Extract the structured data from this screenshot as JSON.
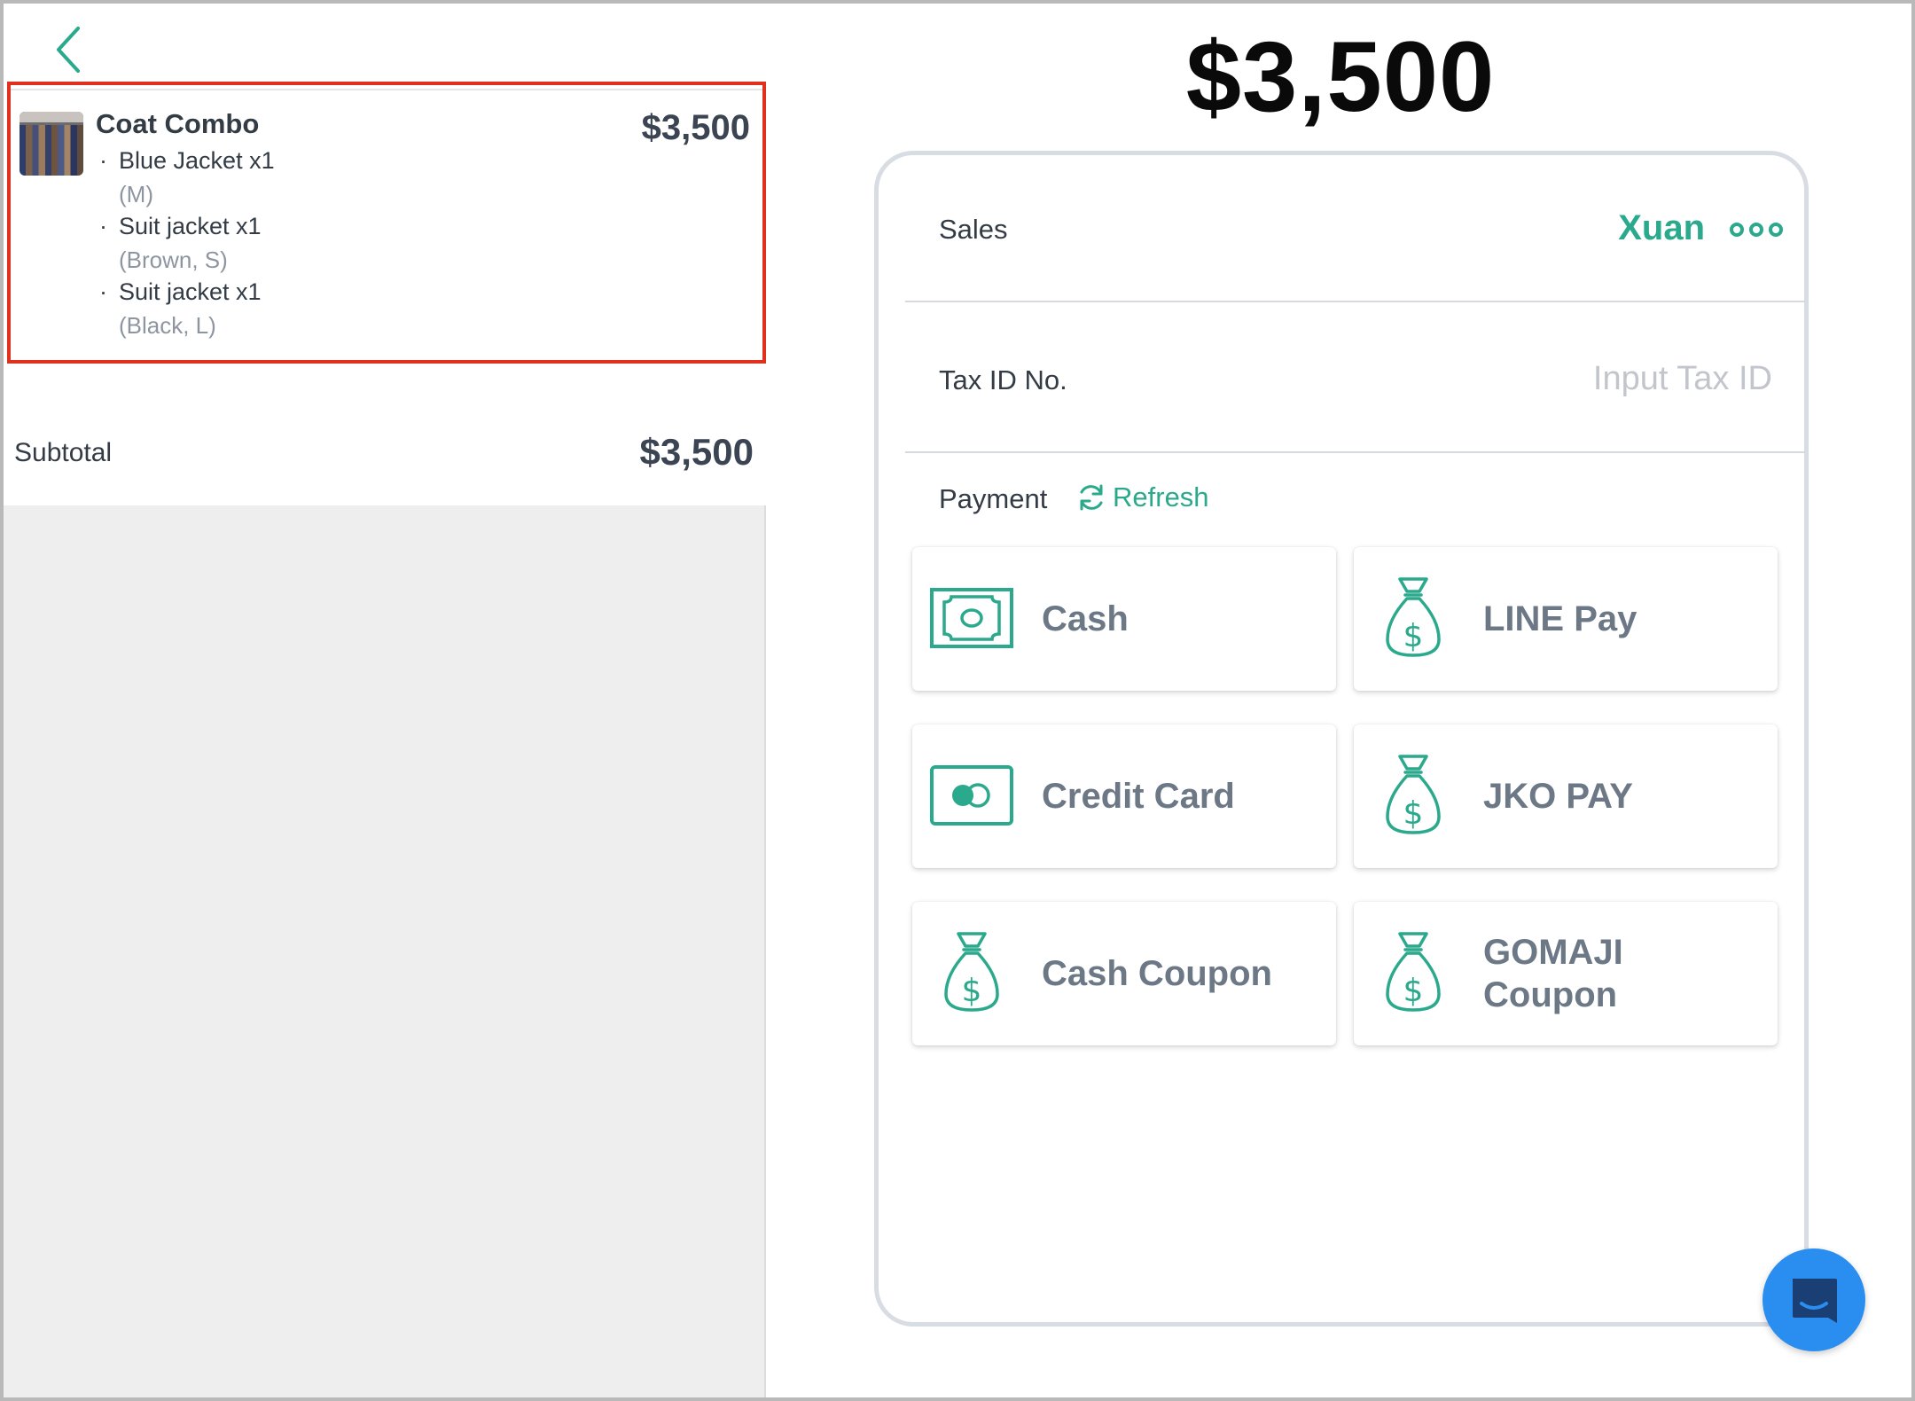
{
  "order": {
    "item": {
      "title": "Coat Combo",
      "price": "$3,500",
      "sub_items": [
        {
          "name": "Blue Jacket x1",
          "variant": "(M)"
        },
        {
          "name": "Suit jacket x1",
          "variant": "(Brown, S)"
        },
        {
          "name": "Suit jacket x1",
          "variant": "(Black, L)"
        }
      ]
    },
    "subtotal_label": "Subtotal",
    "subtotal_value": "$3,500"
  },
  "checkout": {
    "total": "$3,500",
    "sales_label": "Sales",
    "sales_name": "Xuan",
    "tax_label": "Tax ID No.",
    "tax_value": "",
    "tax_placeholder": "Input Tax ID",
    "payment_label": "Payment",
    "refresh_label": "Refresh",
    "methods": [
      {
        "label": "Cash",
        "icon": "cash-bill-icon"
      },
      {
        "label": "LINE Pay",
        "icon": "money-bag-icon"
      },
      {
        "label": "Credit Card",
        "icon": "credit-card-icon"
      },
      {
        "label": "JKO PAY",
        "icon": "money-bag-icon"
      },
      {
        "label": "Cash Coupon",
        "icon": "money-bag-icon"
      },
      {
        "label": "GOMAJI Coupon",
        "icon": "money-bag-icon"
      }
    ]
  },
  "colors": {
    "accent": "#2aa98c",
    "selection_border": "#e0301e",
    "chat_button": "#2a8df0",
    "method_text": "#6d7886"
  },
  "icons": {
    "back": "chevron-left-icon",
    "more": "ellipsis-icon",
    "refresh": "refresh-icon",
    "chat": "chat-icon"
  }
}
